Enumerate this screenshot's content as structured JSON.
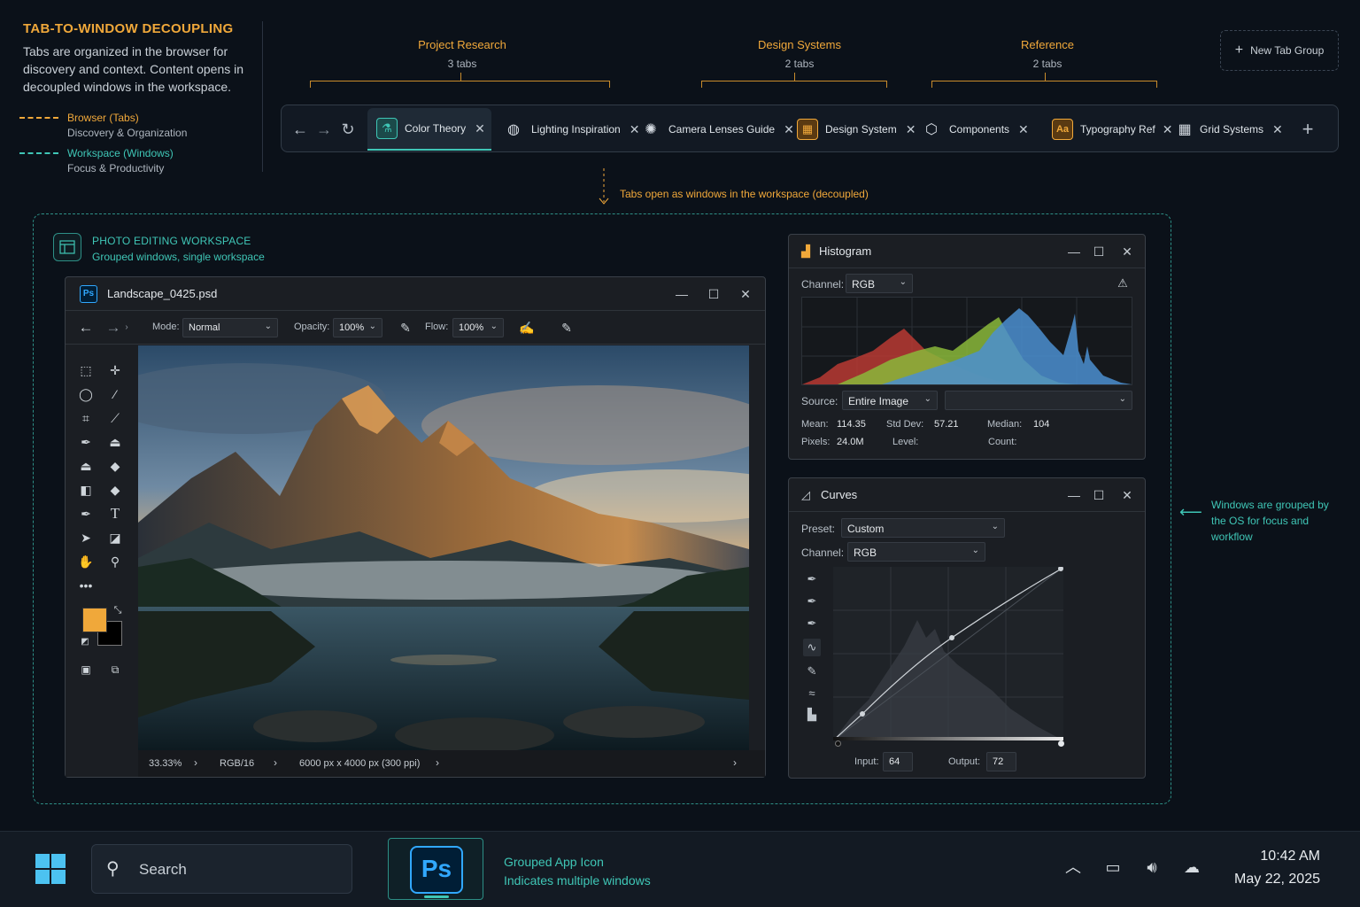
{
  "intro": {
    "title": "TAB-TO-WINDOW DECOUPLING",
    "text": "Tabs are organized in the browser for discovery and context. Content opens in decoupled windows in the workspace.",
    "legend": [
      {
        "label": "Browser (Tabs)",
        "sub": "Discovery & Organization",
        "color": "#f0a83a"
      },
      {
        "label": "Workspace (Windows)",
        "sub": "Focus & Productivity",
        "color": "#3fc6b6"
      }
    ]
  },
  "groups": [
    {
      "name": "Project Research",
      "count": "3 tabs"
    },
    {
      "name": "Design Systems",
      "count": "2 tabs"
    },
    {
      "name": "Reference",
      "count": "2 tabs"
    }
  ],
  "new_tab_group": "New Tab Group",
  "tabs": [
    {
      "label": "Color Theory",
      "icon": "flask-icon",
      "active": true
    },
    {
      "label": "Lighting Inspiration",
      "icon": "globe-icon"
    },
    {
      "label": "Camera Lenses Guide",
      "icon": "aperture-icon"
    },
    {
      "label": "Design System",
      "icon": "grid-icon"
    },
    {
      "label": "Components",
      "icon": "cube-icon"
    },
    {
      "label": "Typography Ref",
      "icon": "type-icon"
    },
    {
      "label": "Grid Systems",
      "icon": "table-grid-icon"
    }
  ],
  "decouple_note": "Tabs open as windows in the workspace (decoupled)",
  "workspace": {
    "title": "PHOTO EDITING WORKSPACE",
    "subtitle": "Grouped windows, single workspace"
  },
  "ps_window": {
    "app_badge": "Ps",
    "title": "Landscape_0425.psd",
    "mode_label": "Mode:",
    "mode_value": "Normal",
    "opacity_label": "Opacity:",
    "opacity_value": "100%",
    "flow_label": "Flow:",
    "flow_value": "100%",
    "status": {
      "zoom": "33.33%",
      "color_mode": "RGB/16",
      "dimensions": "6000 px x 4000 px (300 ppi)"
    },
    "foreground_color": "#f0a83a",
    "background_color": "#000000"
  },
  "histogram": {
    "title": "Histogram",
    "channel_label": "Channel:",
    "channel_value": "RGB",
    "source_label": "Source:",
    "source_value": "Entire Image",
    "stats": {
      "mean_label": "Mean:",
      "mean": "114.35",
      "std_label": "Std Dev:",
      "std": "57.21",
      "median_label": "Median:",
      "median": "104",
      "pixels_label": "Pixels:",
      "pixels": "24.0M",
      "level_label": "Level:",
      "count_label": "Count:"
    }
  },
  "curves": {
    "title": "Curves",
    "preset_label": "Preset:",
    "preset_value": "Custom",
    "channel_label": "Channel:",
    "channel_value": "RGB",
    "input_label": "Input:",
    "input_value": "64",
    "output_label": "Output:",
    "output_value": "72"
  },
  "grouped_note": "Windows are grouped by the OS for focus and workflow",
  "taskbar": {
    "search_placeholder": "Search",
    "ps_badge": "Ps",
    "note_title": "Grouped App Icon",
    "note_sub": "Indicates multiple windows",
    "time": "10:42 AM",
    "date": "May 22, 2025"
  }
}
